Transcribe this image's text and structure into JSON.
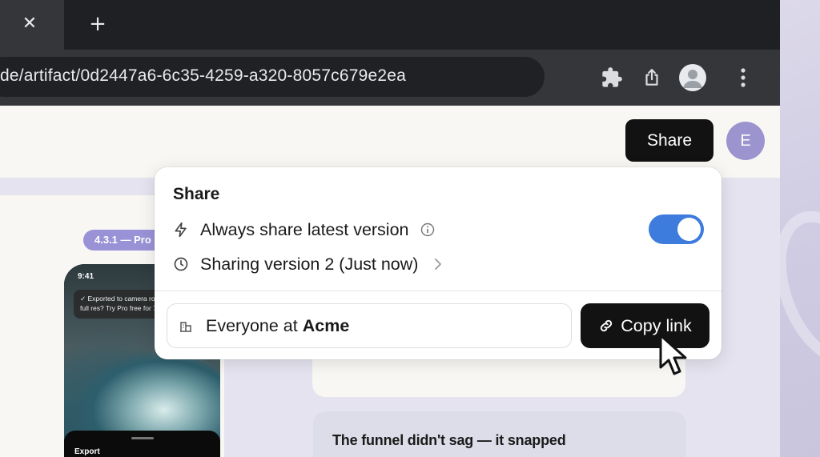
{
  "browser": {
    "tab_close_icon": "close-icon",
    "tab_close_glyph": "✕",
    "new_tab_glyph": "+",
    "url": "de/artifact/0d2447a6-6c35-4259-a320-8057c679e2ea",
    "toolbar_icons": [
      "puzzle-icon",
      "share-icon",
      "profile-icon",
      "more-vert-icon"
    ]
  },
  "header": {
    "share_label": "Share",
    "avatar_initial": "E"
  },
  "background": {
    "version_badge": "4.3.1 — Pro",
    "phone": {
      "time": "9:41",
      "toast_line1": "✓ Exported to camera ro",
      "toast_line2": "full res? Try Pro free for 7",
      "export_label": "Export"
    },
    "card_headline": "The funnel didn't sag — it snapped"
  },
  "share_popover": {
    "title": "Share",
    "always_share_label": "Always share latest version",
    "always_share_enabled": true,
    "version_label": "Sharing version 2 (Just now)",
    "audience_prefix": "Everyone at ",
    "audience_org": "Acme",
    "copy_link_label": "Copy link"
  },
  "colors": {
    "toggle_on": "#3d7bdd",
    "avatar": "#9b94cf",
    "badge": "#9a92d6",
    "dark_button": "#121212"
  }
}
